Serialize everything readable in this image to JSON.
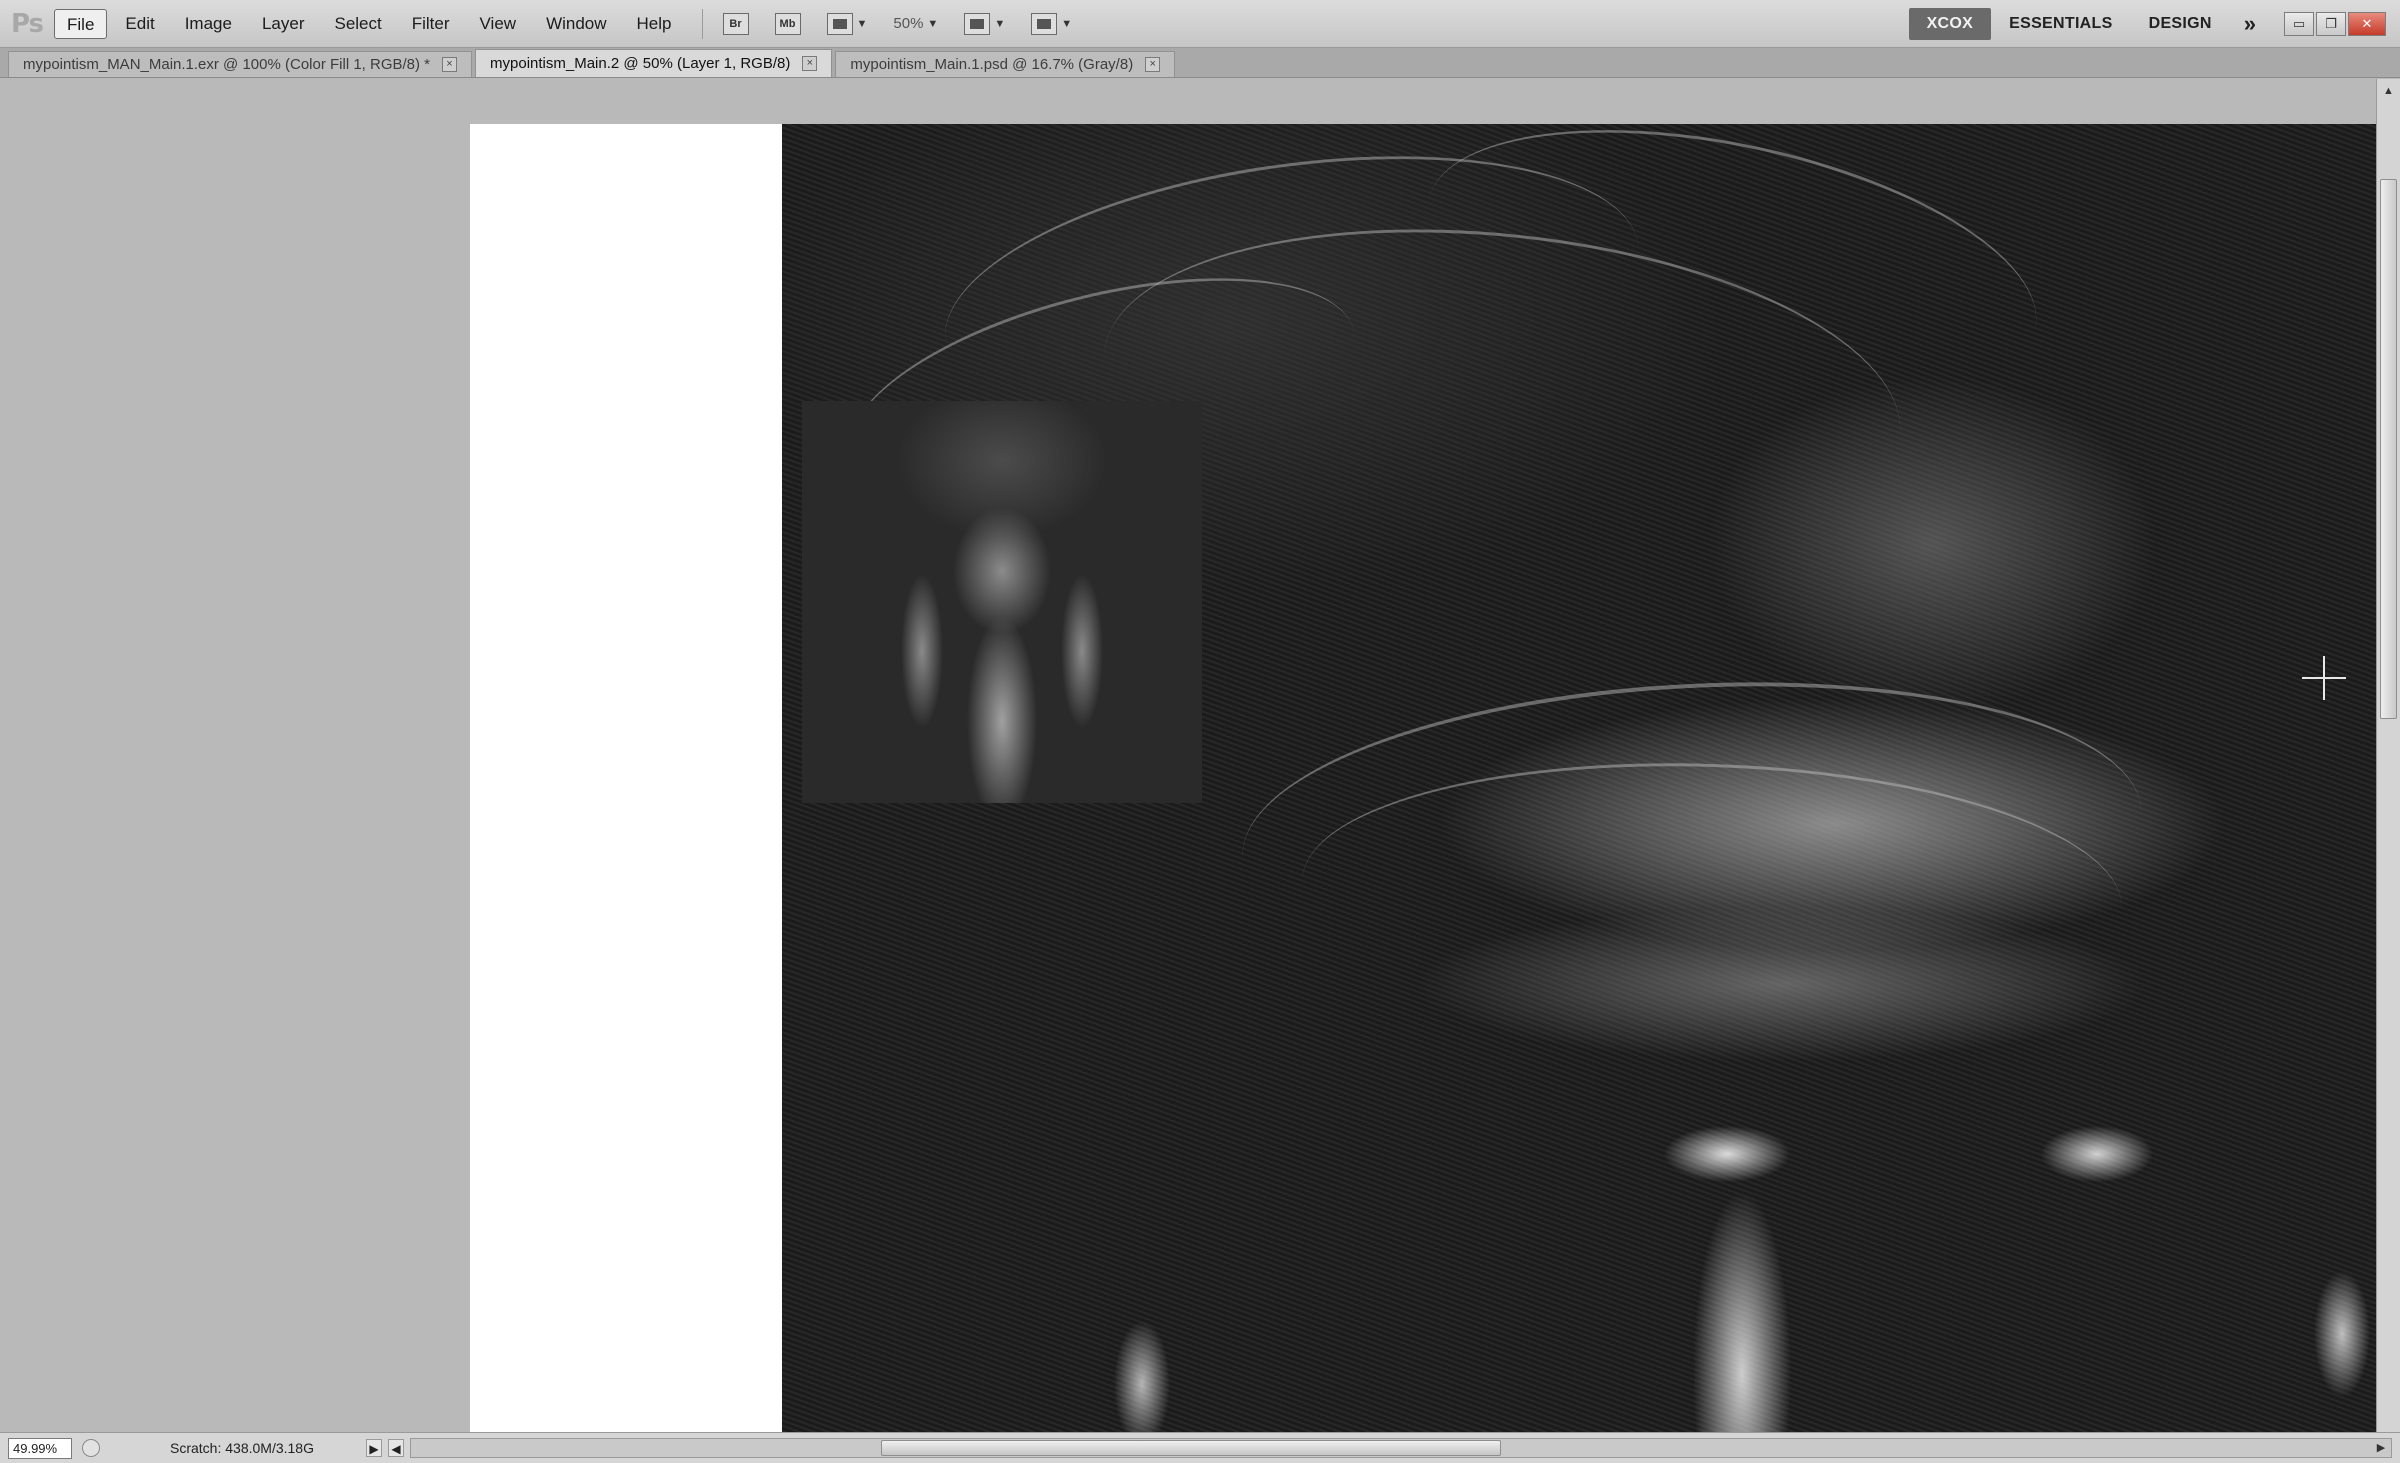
{
  "app": {
    "logo": "Ps"
  },
  "menu": [
    "File",
    "Edit",
    "Image",
    "Layer",
    "Select",
    "Filter",
    "View",
    "Window",
    "Help"
  ],
  "toolbar": {
    "bridge_label": "Br",
    "minibridge_label": "Mb",
    "zoom": "50%"
  },
  "workspaces": {
    "items": [
      "XCOX",
      "ESSENTIALS",
      "DESIGN"
    ],
    "active": "XCOX",
    "more": "»"
  },
  "tabs": [
    {
      "label": "mypointism_MAN_Main.1.exr @ 100% (Color Fill 1, RGB/8) *",
      "active": false
    },
    {
      "label": "mypointism_Main.2 @ 50% (Layer 1, RGB/8)",
      "active": true
    },
    {
      "label": "mypointism_Main.1.psd @ 16.7% (Gray/8)",
      "active": false
    }
  ],
  "tab_close": "×",
  "status": {
    "zoom": "49.99%",
    "scratch": "Scratch: 438.0M/3.18G",
    "arrow_right": "▶",
    "arrow_left": "◀",
    "arrow_end": "▶"
  },
  "scroll": {
    "up": "▲",
    "down": "▼"
  },
  "colors": {
    "chrome": "#c6c6c6",
    "pasteboard": "#b9b9b9",
    "workspace_active": "#6a6a6a",
    "close": "#c63b2a"
  }
}
